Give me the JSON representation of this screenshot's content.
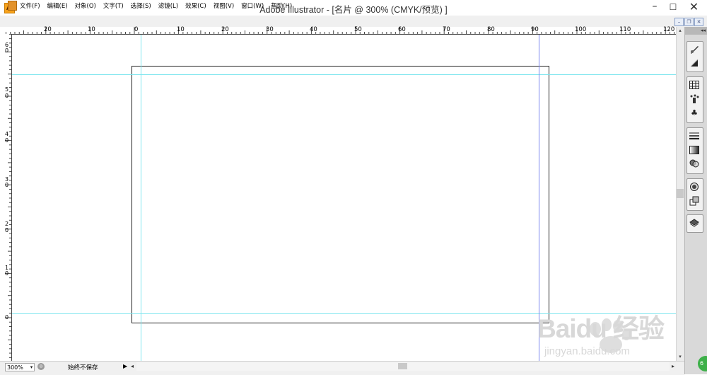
{
  "window": {
    "title": "Adobe Illustrator - [名片 @ 300% (CMYK/预览) ]",
    "app_icon_label": "Ai",
    "minimize": "–",
    "maximize": "☐",
    "close": "✕"
  },
  "menu": {
    "items": [
      "文件(F)",
      "编辑(E)",
      "对象(O)",
      "文字(T)",
      "选择(S)",
      "滤镜(L)",
      "效果(C)",
      "视图(V)",
      "窗口(W)",
      "帮助(H)"
    ],
    "doc_min": "–",
    "doc_restore": "❐",
    "doc_close": "✕"
  },
  "ruler": {
    "top_labels": [
      "20",
      "10",
      "0",
      "10",
      "20",
      "30",
      "40",
      "50",
      "60",
      "70",
      "80",
      "90",
      "100",
      "110",
      "120"
    ],
    "left_labels": [
      "6",
      "0",
      "5",
      "0",
      "4",
      "0",
      "3",
      "0",
      "2",
      "0",
      "1",
      "0",
      "0"
    ]
  },
  "panel": {
    "collapse": "◂◂",
    "tools": [
      "brush-icon",
      "gradient-triangle-icon",
      "swatches-grid-icon",
      "symbol-sprayer-icon",
      "club-symbol-icon",
      "stroke-lines-icon",
      "gradient-icon",
      "transparency-icon",
      "appearance-icon",
      "graphic-styles-icon",
      "layers-icon"
    ]
  },
  "status": {
    "zoom": "300%",
    "zoom_arrow": "▾",
    "nav_icon": "◎",
    "text": "始终不保存",
    "more_arrow": "▶",
    "scroll_left": "◂",
    "scroll_right": "▸",
    "scroll_up": "▴",
    "scroll_down": "▾"
  },
  "watermark": {
    "brand": "Baidu 经验",
    "url": "jingyan.baidu.com",
    "badge": "6"
  }
}
